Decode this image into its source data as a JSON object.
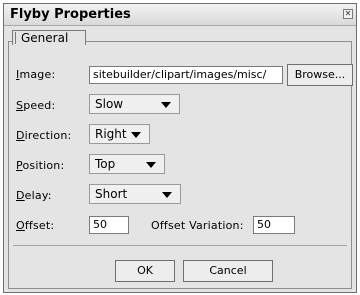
{
  "dialog": {
    "title": "Flyby Properties",
    "tab_general": "General"
  },
  "fields": {
    "image_label_prefix": "",
    "image_label_underlined": "I",
    "image_label_rest": "mage:",
    "image_value": "sitebuilder/clipart/images/misc/",
    "browse_label": "Browse...",
    "speed_label_underlined": "S",
    "speed_label_rest": "peed:",
    "speed_value": "Slow",
    "direction_label_underlined": "D",
    "direction_label_rest": "irection:",
    "direction_value": "Right",
    "position_label_underlined": "P",
    "position_label_rest": "osition:",
    "position_value": "Top",
    "delay_label_underlined": "D",
    "delay_label_rest": "elay:",
    "delay_value": "Short",
    "offset_label_underlined": "O",
    "offset_label_rest": "ffset:",
    "offset_value": "50",
    "offset_variation_label": "Offset Variation:",
    "offset_variation_value": "50"
  },
  "buttons": {
    "ok": "OK",
    "cancel": "Cancel"
  }
}
